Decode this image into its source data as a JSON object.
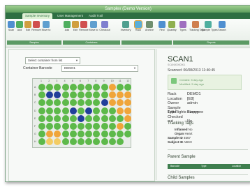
{
  "app": {
    "title": "Samplex (Demo Version)"
  },
  "tabs": [
    "Sample Inventory",
    "User Management",
    "Audit Trail"
  ],
  "ribbon": {
    "buttons": [
      {
        "label": "Scan",
        "icon": "scan-icon",
        "color": "#4f8fd0"
      },
      {
        "label": "Add",
        "icon": "add-icon",
        "color": "#4fae5f"
      },
      {
        "label": "Edit",
        "icon": "edit-icon",
        "color": "#d09f3f"
      },
      {
        "label": "Remove",
        "icon": "remove-icon",
        "color": "#d0504f"
      },
      {
        "label": "Move to",
        "icon": "move-icon",
        "color": "#5f9fcf"
      },
      {
        "label": "Add",
        "icon": "add-icon",
        "color": "#4fae5f"
      },
      {
        "label": "Edit",
        "icon": "edit-icon",
        "color": "#d09f3f"
      },
      {
        "label": "Remove",
        "icon": "remove-icon",
        "color": "#d0504f"
      },
      {
        "label": "Move to",
        "icon": "move-icon",
        "color": "#5f9fcf"
      },
      {
        "label": "Checkout",
        "icon": "checkout-icon",
        "color": "#7f7fcf"
      },
      {
        "label": "Inventory",
        "icon": "inventory-icon",
        "color": "#4f9f8f"
      },
      {
        "label": "Rack",
        "icon": "rack-icon",
        "color": "#e0a030"
      },
      {
        "label": "Archive",
        "icon": "archive-icon",
        "color": "#6f8f6f"
      },
      {
        "label": "Find",
        "icon": "find-icon",
        "color": "#4f8fd0"
      },
      {
        "label": "Quantity",
        "icon": "quantity-icon",
        "color": "#8faf4f"
      },
      {
        "label": "Types",
        "icon": "types-icon",
        "color": "#9f6fbf"
      },
      {
        "label": "Tracking Tags",
        "icon": "tags-icon",
        "color": "#cf7f4f"
      },
      {
        "label": "Sample Types",
        "icon": "sample-types-icon",
        "color": "#4faf9f"
      },
      {
        "label": "Search",
        "icon": "search-icon",
        "color": "#4f8fd0"
      }
    ],
    "groups": [
      "Samples",
      "Containers",
      "",
      "Reports"
    ]
  },
  "left": {
    "container_select": "Select container from list",
    "container_barcode_label": "Container Barcode",
    "container_barcode_value": "DEMO1",
    "plate": {
      "columns": [
        "1",
        "2",
        "3",
        "4",
        "5",
        "6",
        "7",
        "8",
        "9",
        "10",
        "11",
        "12"
      ],
      "rows": [
        "A",
        "B",
        "C",
        "D",
        "E",
        "F",
        "G",
        "H"
      ],
      "palette": {
        "g": "#5db94a",
        "b": "#213f9a",
        "o": "#f0a53a",
        "y": "#f3cc63"
      },
      "wells": [
        "gggggggggogg",
        "gbbggggggooo",
        "ggggggggbooo",
        "ggggbgbgggoo",
        "gggggbgggggo",
        "ggggggggggog",
        "googgggggggg",
        "gyygggggggg"
      ]
    }
  },
  "right": {
    "scan_title": "SCAN1",
    "scan_sub": "SCAN00000001",
    "scanned": "Scanned: 06/08/2013 11:46:45",
    "created": "Created: 5 day ago",
    "modified": "Modified: 5 day ago",
    "fields": [
      {
        "k": "Rack",
        "v": "DEMO1"
      },
      {
        "k": "Location",
        "v": "[E8]"
      },
      {
        "k": "Owner",
        "v": "admin"
      },
      {
        "k": "Sample Type",
        "v": "Biopsy"
      },
      {
        "k": "Edit Rights",
        "v": "Everyone"
      },
      {
        "k": "Checked out",
        "v": "No"
      }
    ],
    "tracking_tags_title": "Tracking Tags",
    "tags": [
      {
        "k": "Inflamed",
        "v": "No"
      },
      {
        "k": "Organ",
        "v": "Heart"
      },
      {
        "k": "Sample ID",
        "v": "4567"
      },
      {
        "k": "Subject ID",
        "v": "ABC0"
      }
    ],
    "parent_sample_title": "Parent Sample",
    "parent_table_headers": [
      "Barcode",
      "Type",
      "Location"
    ],
    "child_samples_title": "Child Samples"
  }
}
